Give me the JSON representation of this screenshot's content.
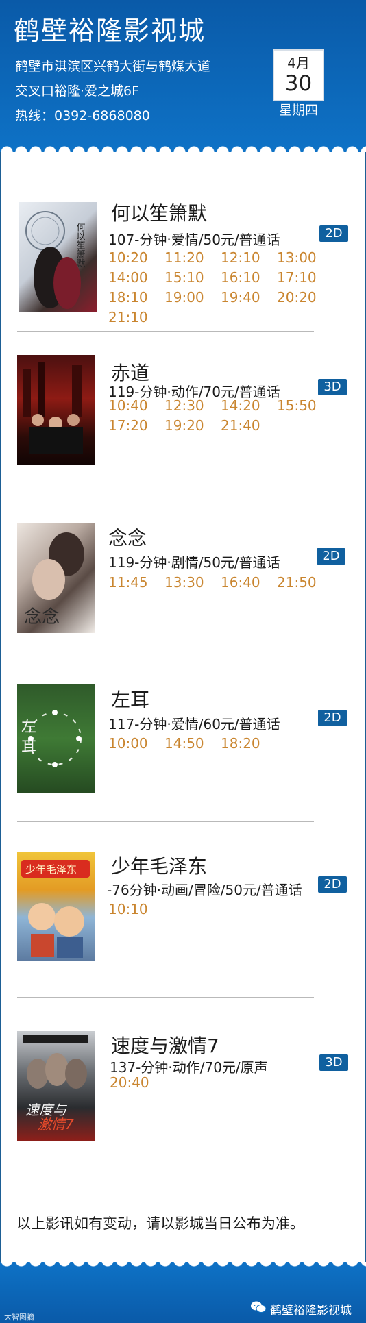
{
  "header": {
    "title": "鹤壁裕隆影视城",
    "address_line1": "鹤壁市淇滨区兴鹤大街与鹤煤大道",
    "address_line2": "交叉口裕隆·爱之城6F",
    "hotline": "热线：0392-6868080",
    "month": "4月",
    "day": "30",
    "weekday": "星期四"
  },
  "movies": [
    {
      "title": "何以笙箫默",
      "info": "107-分钟·爱情/50元/普通话",
      "format": "2D",
      "times": [
        "10:20",
        "11:20",
        "12:10",
        "13:00",
        "14:00",
        "15:10",
        "16:10",
        "17:10",
        "18:10",
        "19:00",
        "19:40",
        "20:20",
        "21:10"
      ]
    },
    {
      "title": "赤道",
      "info": "119-分钟·动作/70元/普通话",
      "format": "3D",
      "times": [
        "10:40",
        "12:30",
        "14:20",
        "15:50",
        "17:20",
        "19:20",
        "21:40"
      ]
    },
    {
      "title": "念念",
      "info": "119-分钟·剧情/50元/普通话",
      "format": "2D",
      "times": [
        "11:45",
        "13:30",
        "16:40",
        "21:50"
      ]
    },
    {
      "title": "左耳",
      "info": "117-分钟·爱情/60元/普通话",
      "format": "2D",
      "times": [
        "10:00",
        "14:50",
        "18:20"
      ]
    },
    {
      "title": "少年毛泽东",
      "info": "-76分钟·动画/冒险/50元/普通话",
      "format": "2D",
      "times": [
        "10:10"
      ]
    },
    {
      "title": "速度与激情7",
      "info": "137-分钟·动作/70元/原声",
      "format": "3D",
      "times": [
        "20:40"
      ]
    }
  ],
  "notice": "以上影讯如有变动，请以影城当日公布为准。",
  "footer": {
    "logo_text": "大智图摘",
    "wechat_name": "鹤壁裕隆影视城"
  },
  "colors": {
    "header_blue": "#0e72c6",
    "time_orange": "#c9852f",
    "badge_blue": "#10609f"
  }
}
